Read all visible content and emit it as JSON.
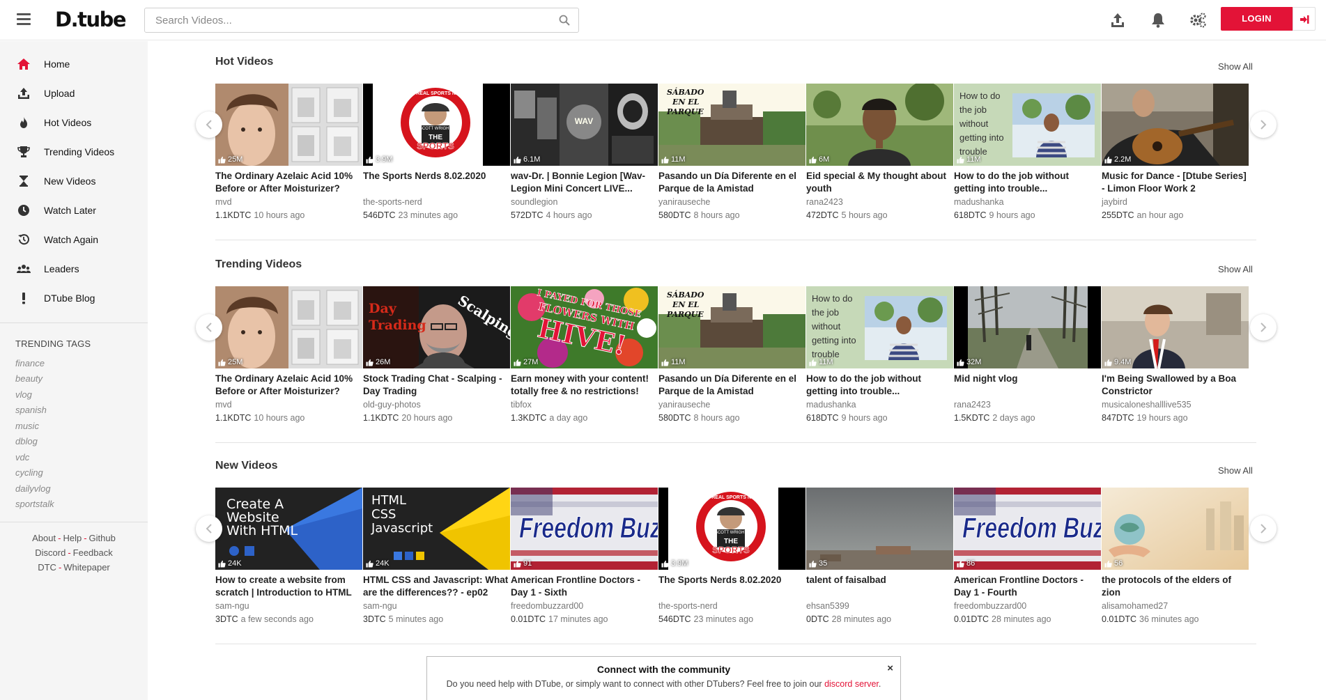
{
  "brand": {
    "logo_text": "D.tube",
    "accent": "#e31337"
  },
  "search": {
    "placeholder": "Search Videos..."
  },
  "header": {
    "login_label": "LOGIN"
  },
  "sidebar": {
    "items": [
      {
        "label": "Home",
        "icon": "home-icon"
      },
      {
        "label": "Upload",
        "icon": "upload-icon"
      },
      {
        "label": "Hot Videos",
        "icon": "flame-icon"
      },
      {
        "label": "Trending Videos",
        "icon": "trophy-icon"
      },
      {
        "label": "New Videos",
        "icon": "hourglass-icon"
      },
      {
        "label": "Watch Later",
        "icon": "clock-icon"
      },
      {
        "label": "Watch Again",
        "icon": "history-icon"
      },
      {
        "label": "Leaders",
        "icon": "users-icon"
      },
      {
        "label": "DTube Blog",
        "icon": "exclamation-icon"
      }
    ],
    "trending_title": "TRENDING TAGS",
    "tags": [
      "finance",
      "beauty",
      "vlog",
      "spanish",
      "music",
      "dblog",
      "vdc",
      "cycling",
      "dailyvlog",
      "sportstalk"
    ],
    "footer": {
      "about": "About",
      "help": "Help",
      "github": "Github",
      "discord": "Discord",
      "feedback": "Feedback",
      "dtc": "DTC",
      "whitepaper": "Whitepaper",
      "separator": "-"
    }
  },
  "sections": [
    {
      "title": "Hot Videos",
      "show_all": "Show All",
      "videos": [
        {
          "title": "The Ordinary Azelaic Acid 10% Before or After Moisturizer?",
          "author": "mvd",
          "dtc": "1.1KDTC",
          "ago": "10 hours ago",
          "views": "25M",
          "thumb": "azelaic"
        },
        {
          "title": "The Sports Nerds 8.02.2020",
          "author": "the-sports-nerd",
          "dtc": "546DTC",
          "ago": "23 minutes ago",
          "views": "3.9M",
          "thumb": "sportsnerd"
        },
        {
          "title": "wav-Dr. | Bonnie Legion [Wav-Legion Mini Concert LIVE...",
          "author": "soundlegion",
          "dtc": "572DTC",
          "ago": "4 hours ago",
          "views": "6.1M",
          "thumb": "wav"
        },
        {
          "title": "Pasando un Día Diferente en el Parque de la Amistad",
          "author": "yanirauseche",
          "dtc": "580DTC",
          "ago": "8 hours ago",
          "views": "11M",
          "thumb": "parque"
        },
        {
          "title": "Eid special & My thought about youth",
          "author": "rana2423",
          "dtc": "472DTC",
          "ago": "5 hours ago",
          "views": "6M",
          "thumb": "eid"
        },
        {
          "title": "How to do the job without getting into trouble...",
          "author": "madushanka",
          "dtc": "618DTC",
          "ago": "9 hours ago",
          "views": "11M",
          "thumb": "howto"
        },
        {
          "title": "Music for Dance - [Dtube Series] - Limon Floor Work 2",
          "author": "jaybird",
          "dtc": "255DTC",
          "ago": "an hour ago",
          "views": "2.2M",
          "thumb": "guitar"
        }
      ]
    },
    {
      "title": "Trending Videos",
      "show_all": "Show All",
      "videos": [
        {
          "title": "The Ordinary Azelaic Acid 10% Before or After Moisturizer?",
          "author": "mvd",
          "dtc": "1.1KDTC",
          "ago": "10 hours ago",
          "views": "25M",
          "thumb": "azelaic"
        },
        {
          "title": "Stock Trading Chat - Scalping - Day Trading",
          "author": "old-guy-photos",
          "dtc": "1.1KDTC",
          "ago": "20 hours ago",
          "views": "26M",
          "thumb": "scalping"
        },
        {
          "title": "Earn money with your content! totally free & no restrictions!",
          "author": "tibfox",
          "dtc": "1.3KDTC",
          "ago": "a day ago",
          "views": "27M",
          "thumb": "hive"
        },
        {
          "title": "Pasando un Día Diferente en el Parque de la Amistad",
          "author": "yanirauseche",
          "dtc": "580DTC",
          "ago": "8 hours ago",
          "views": "11M",
          "thumb": "parque"
        },
        {
          "title": "How to do the job without getting into trouble...",
          "author": "madushanka",
          "dtc": "618DTC",
          "ago": "9 hours ago",
          "views": "11M",
          "thumb": "howto"
        },
        {
          "title": "Mid night vlog",
          "author": "rana2423",
          "dtc": "1.5KDTC",
          "ago": "2 days ago",
          "views": "32M",
          "thumb": "road"
        },
        {
          "title": "I'm Being Swallowed by a Boa Constrictor",
          "author": "musicaloneshalllive535",
          "dtc": "847DTC",
          "ago": "19 hours ago",
          "views": "9.4M",
          "thumb": "boa"
        }
      ]
    },
    {
      "title": "New Videos",
      "show_all": "Show All",
      "videos": [
        {
          "title": "How to create a website from scratch | Introduction to HTML -...",
          "author": "sam-ngu",
          "dtc": "3DTC",
          "ago": "a few seconds ago",
          "views": "24K",
          "thumb": "website"
        },
        {
          "title": "HTML CSS and Javascript: What are the differences?? - ep02",
          "author": "sam-ngu",
          "dtc": "3DTC",
          "ago": "5 minutes ago",
          "views": "24K",
          "thumb": "htmlcss"
        },
        {
          "title": "American Frontline Doctors - Day 1 - Sixth",
          "author": "freedombuzzard00",
          "dtc": "0.01DTC",
          "ago": "17 minutes ago",
          "views": "91",
          "thumb": "freedom"
        },
        {
          "title": "The Sports Nerds 8.02.2020",
          "author": "the-sports-nerd",
          "dtc": "546DTC",
          "ago": "23 minutes ago",
          "views": "3.9M",
          "thumb": "sportsnerd"
        },
        {
          "title": "talent of faisalbad",
          "author": "ehsan5399",
          "dtc": "0DTC",
          "ago": "28 minutes ago",
          "views": "35",
          "thumb": "sky"
        },
        {
          "title": "American Frontline Doctors - Day 1 - Fourth",
          "author": "freedombuzzard00",
          "dtc": "0.01DTC",
          "ago": "28 minutes ago",
          "views": "86",
          "thumb": "freedom"
        },
        {
          "title": "the protocols of the elders of zion",
          "author": "alisamohamed27",
          "dtc": "0.01DTC",
          "ago": "36 minutes ago",
          "views": "56",
          "thumb": "globe"
        }
      ]
    }
  ],
  "thumb_text": {
    "howto": [
      "How to do",
      "the job",
      "without",
      "getting into",
      "trouble"
    ],
    "parque": [
      "SÁBADO",
      "EN EL",
      "PARQUE"
    ],
    "sportsnerd": [
      "THE REAL SPORTS NERD",
      "SCOTT WRIGHT",
      "THE",
      "SPORTS",
      "NERDS"
    ],
    "wav": "WAV",
    "scalping": [
      "Day",
      "Trading",
      "Scalping"
    ],
    "hive": [
      "I PAYED FOR THOSE",
      "FLOWERS WITH",
      "HIVE!"
    ],
    "website": [
      "Create A",
      "Website",
      "With HTML"
    ],
    "htmlcss": [
      "HTML",
      "CSS",
      "Javascript"
    ],
    "freedom": "Freedom Buzz"
  },
  "community": {
    "title": "Connect with the community",
    "text": "Do you need help with DTube, or simply want to connect with other DTubers? Feel free to join our",
    "link": "discord server",
    "end": ".",
    "close": "×"
  }
}
